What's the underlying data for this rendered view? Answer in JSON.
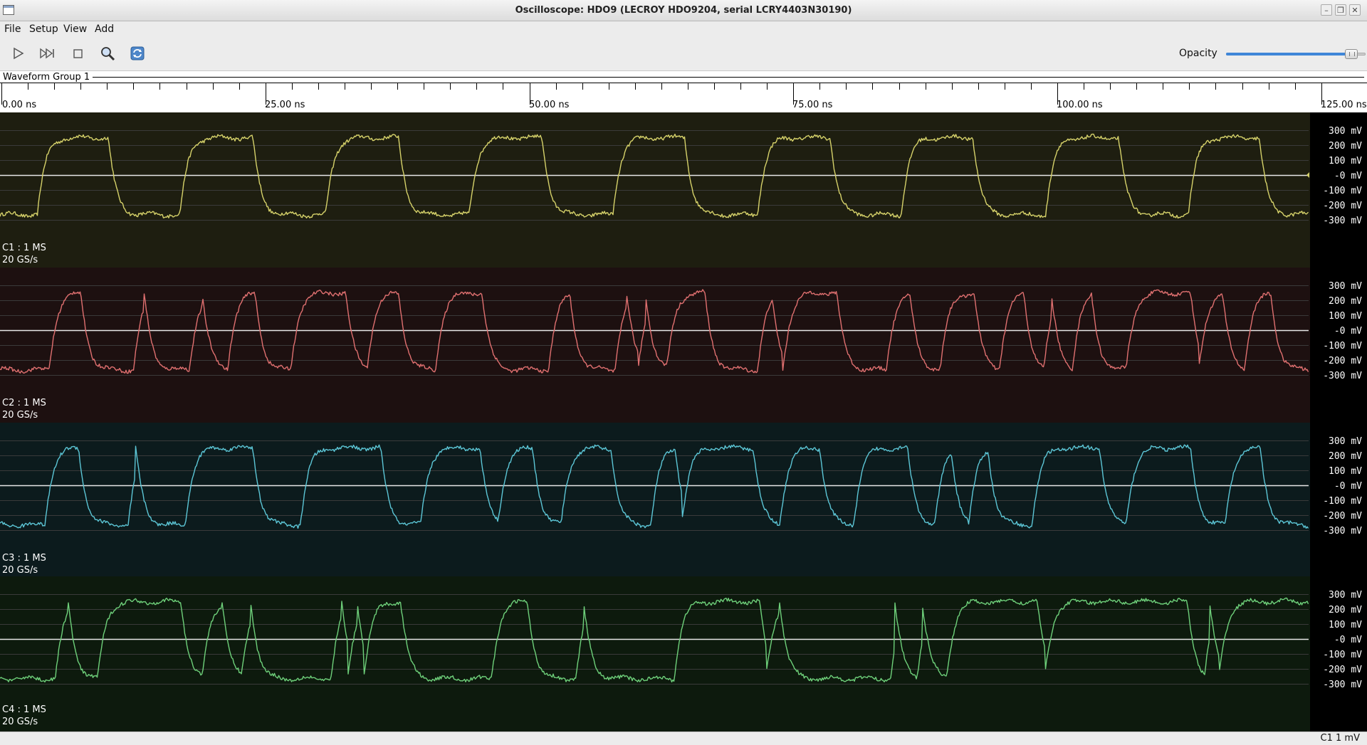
{
  "window": {
    "title": "Oscilloscope: HDO9 (LECROY HDO9204, serial LCRY4403N30190)",
    "controls": [
      "minimize-icon",
      "restore-icon",
      "close-icon"
    ]
  },
  "menu": {
    "items": [
      "File",
      "Setup",
      "View",
      "Add"
    ]
  },
  "toolbar": {
    "buttons": [
      "play-icon",
      "step-forward-icon",
      "stop-icon",
      "zoom-icon",
      "refresh-icon"
    ],
    "opacity_label": "Opacity",
    "opacity_value": 0.9
  },
  "group": {
    "title": "Waveform Group 1"
  },
  "time_axis": {
    "labels": [
      "0.00 ns",
      "25.00 ns",
      "50.00 ns",
      "75.00 ns",
      "100.00 ns",
      "125.00 ns"
    ],
    "major_values_ns": [
      0,
      25,
      50,
      75,
      100,
      125
    ],
    "minor_step_ns": 2.5
  },
  "voltage_labels": [
    "300 mV",
    "200 mV",
    "100 mV",
    "-0 mV",
    "-100 mV",
    "-200 mV",
    "-300 mV"
  ],
  "channels": [
    {
      "id": "C1",
      "info": "C1 : 1 MS",
      "rate": "20 GS/s",
      "color": "#d6d26a",
      "bg": "#1e1e10",
      "edges_ns": [
        3.4,
        10.1,
        16.9,
        23.8,
        30.7,
        37.6,
        44.3,
        51.2,
        57.9,
        64.7,
        71.6,
        78.5,
        85.2,
        92.0,
        98.9,
        105.8,
        112.4,
        119.1
      ]
    },
    {
      "id": "C2",
      "info": "C2 : 1 MS",
      "rate": "20 GS/s",
      "color": "#e07070",
      "bg": "#1d1010",
      "edges_ns": [
        4.5,
        7.5,
        12.5,
        13.5,
        17.8,
        19.0,
        21.4,
        24.0,
        27.4,
        32.6,
        34.6,
        37.6,
        41.1,
        45.5,
        51.8,
        53.8,
        58.1,
        59.2,
        60.3,
        61.0,
        63.0,
        66.6,
        71.6,
        72.9,
        74.0,
        79.1,
        83.8,
        86.0,
        88.9,
        92.1,
        94.5,
        96.8,
        98.7,
        99.4,
        101.4,
        103.2,
        106.5,
        112.6,
        113.4,
        115.6,
        117.7,
        120.2
      ]
    },
    {
      "id": "C3",
      "info": "C3 : 1 MS",
      "rate": "20 GS/s",
      "color": "#5cc6d6",
      "bg": "#0c1b1d",
      "edges_ns": [
        4.1,
        7.3,
        12.0,
        12.7,
        17.4,
        23.8,
        28.3,
        35.9,
        39.7,
        45.3,
        47.0,
        50.3,
        53.0,
        57.7,
        61.5,
        63.8,
        64.4,
        71.2,
        73.7,
        77.5,
        80.7,
        85.8,
        88.4,
        89.9,
        91.6,
        93.4,
        97.6,
        104.0,
        106.5,
        112.6,
        115.9,
        119.2
      ]
    },
    {
      "id": "C4",
      "info": "C4 : 1 MS",
      "rate": "20 GS/s",
      "color": "#6ed07a",
      "bg": "#0d1a0d",
      "edges_ns": [
        5.1,
        6.3,
        9.1,
        17.0,
        19.0,
        20.9,
        22.7,
        23.6,
        31.2,
        32.2,
        32.8,
        33.7,
        34.3,
        37.8,
        46.4,
        49.8,
        54.4,
        55.1,
        63.7,
        71.8,
        72.4,
        73.7,
        84.2,
        84.6,
        86.7,
        87.2,
        89.5,
        98.1,
        98.8,
        112.3,
        113.9,
        114.4,
        115.3
      ]
    }
  ],
  "status": {
    "text": "C1 1 mV"
  }
}
